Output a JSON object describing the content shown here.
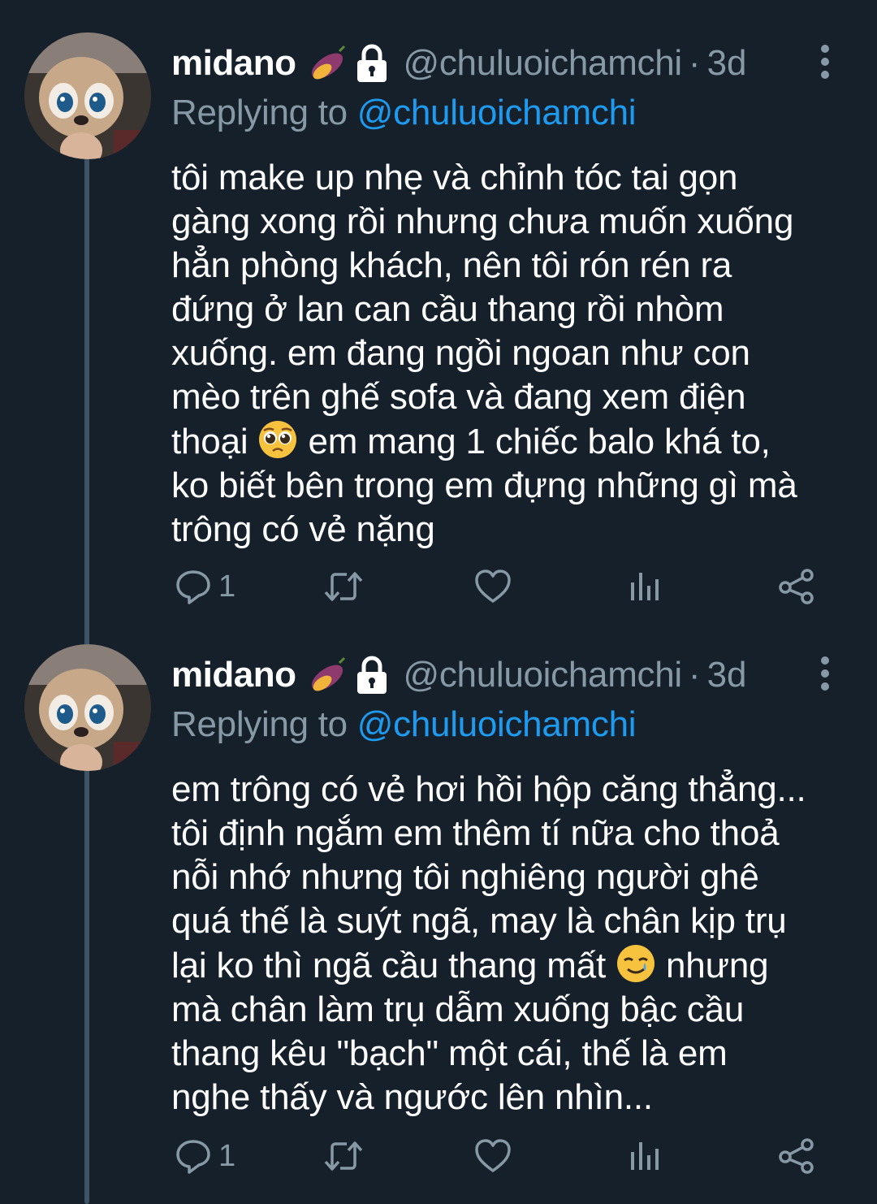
{
  "tweets": [
    {
      "display_name": "midano",
      "name_emoji": "sweet-potato-icon",
      "protected_icon": "lock-icon",
      "handle": "@chuluoichamchi",
      "separator": "·",
      "age": "3d",
      "replying_label": "Replying to",
      "replying_to": "@chuluoichamchi",
      "text_before_emoji": "tôi make up nhẹ và chỉnh tóc tai gọn\ngàng xong rồi nhưng chưa muốn xuống\nhẳn phòng khách, nên tôi rón rén ra\nđứng ở lan can cầu thang rồi nhòm\nxuống. em đang ngồi ngoan như con\nmèo trên ghế sofa và đang xem điện\nthoại",
      "inline_emoji": "pleading-face-icon",
      "text_after_emoji": "em mang 1 chiếc balo khá to,\nko biết bên trong em đựng những gì mà\ntrông có vẻ nặng",
      "reply_count": "1",
      "retweet_count": "",
      "like_count": ""
    },
    {
      "display_name": "midano",
      "name_emoji": "sweet-potato-icon",
      "protected_icon": "lock-icon",
      "handle": "@chuluoichamchi",
      "separator": "·",
      "age": "3d",
      "replying_label": "Replying to",
      "replying_to": "@chuluoichamchi",
      "text_before_emoji": "em trông có vẻ hơi hồi hộp căng thẳng...\ntôi định ngắm em thêm tí nữa cho thoả\nnỗi nhớ nhưng tôi nghiêng người ghê\nquá thế là suýt ngã, may là chân kịp trụ\nlại ko thì ngã cầu thang mất",
      "inline_emoji": "smiling-face-with-tear-icon",
      "text_after_emoji": "nhưng\nmà chân làm trụ dẫm xuống bậc cầu\nthang kêu \"bạch\" một cái, thế là em\nnghe thấy và ngước lên nhìn...",
      "reply_count": "1",
      "retweet_count": "",
      "like_count": ""
    }
  ],
  "colors": {
    "background": "#15202b",
    "secondary_text": "#8899a6",
    "link": "#1d9bf0",
    "thread_line": "#3d5466"
  }
}
